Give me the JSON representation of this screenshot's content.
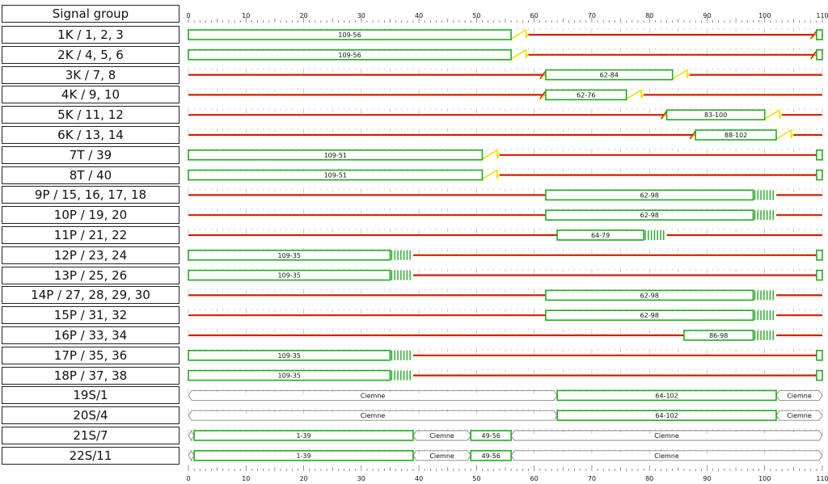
{
  "header_label": "Signal group",
  "chart_data": {
    "type": "timeline",
    "xlim": [
      0,
      110
    ],
    "ticks": [
      0,
      10,
      20,
      30,
      40,
      50,
      60,
      70,
      80,
      90,
      100,
      110
    ],
    "colors": {
      "red": "#cc2200",
      "green": "#22aa22",
      "amber": "#f0e000",
      "grey": "#888888"
    },
    "rows": [
      {
        "label": "1K / 1, 2, 3",
        "kind": "vehicle",
        "greens": [
          {
            "start": 0,
            "end": 56,
            "label": "109-56"
          },
          {
            "start": 109,
            "end": 110,
            "label": ""
          }
        ],
        "ambers": [
          [
            56,
            59
          ]
        ],
        "redambers": [
          [
            108,
            109
          ]
        ]
      },
      {
        "label": "2K / 4, 5, 6",
        "kind": "vehicle",
        "greens": [
          {
            "start": 0,
            "end": 56,
            "label": "109-56"
          },
          {
            "start": 109,
            "end": 110,
            "label": ""
          }
        ],
        "ambers": [
          [
            56,
            59
          ]
        ],
        "redambers": [
          [
            108,
            109
          ]
        ]
      },
      {
        "label": "3K / 7, 8",
        "kind": "vehicle",
        "greens": [
          {
            "start": 62,
            "end": 84,
            "label": "62-84"
          }
        ],
        "ambers": [
          [
            84,
            87
          ]
        ],
        "redambers": [
          [
            61,
            62
          ]
        ]
      },
      {
        "label": "4K / 9, 10",
        "kind": "vehicle",
        "greens": [
          {
            "start": 62,
            "end": 76,
            "label": "62-76"
          }
        ],
        "ambers": [
          [
            76,
            79
          ]
        ],
        "redambers": [
          [
            61,
            62
          ]
        ]
      },
      {
        "label": "5K / 11, 12",
        "kind": "vehicle",
        "greens": [
          {
            "start": 83,
            "end": 100,
            "label": "83-100"
          }
        ],
        "ambers": [
          [
            100,
            103
          ]
        ],
        "redambers": [
          [
            82,
            83
          ]
        ]
      },
      {
        "label": "6K / 13, 14",
        "kind": "vehicle",
        "greens": [
          {
            "start": 88,
            "end": 102,
            "label": "88-102"
          }
        ],
        "ambers": [
          [
            102,
            105
          ]
        ],
        "redambers": [
          [
            87,
            88
          ]
        ]
      },
      {
        "label": "7T / 39",
        "kind": "vehicle",
        "greens": [
          {
            "start": 0,
            "end": 51,
            "label": "109-51"
          },
          {
            "start": 109,
            "end": 110,
            "label": ""
          }
        ],
        "ambers": [
          [
            51,
            54
          ]
        ],
        "redambers": []
      },
      {
        "label": "8T / 40",
        "kind": "vehicle",
        "greens": [
          {
            "start": 0,
            "end": 51,
            "label": "109-51"
          },
          {
            "start": 109,
            "end": 110,
            "label": ""
          }
        ],
        "ambers": [
          [
            51,
            54
          ]
        ],
        "redambers": []
      },
      {
        "label": "9P / 15, 16, 17, 18",
        "kind": "pedestrian",
        "greens": [
          {
            "start": 62,
            "end": 98,
            "label": "62-98"
          }
        ],
        "flashing": [
          [
            98,
            102
          ]
        ]
      },
      {
        "label": "10P / 19, 20",
        "kind": "pedestrian",
        "greens": [
          {
            "start": 62,
            "end": 98,
            "label": "62-98"
          }
        ],
        "flashing": [
          [
            98,
            102
          ]
        ]
      },
      {
        "label": "11P / 21, 22",
        "kind": "pedestrian",
        "greens": [
          {
            "start": 64,
            "end": 79,
            "label": "64-79"
          }
        ],
        "flashing": [
          [
            79,
            83
          ]
        ]
      },
      {
        "label": "12P / 23, 24",
        "kind": "pedestrian",
        "greens": [
          {
            "start": 0,
            "end": 35,
            "label": "109-35"
          },
          {
            "start": 109,
            "end": 110,
            "label": ""
          }
        ],
        "flashing": [
          [
            35,
            39
          ]
        ]
      },
      {
        "label": "13P / 25, 26",
        "kind": "pedestrian",
        "greens": [
          {
            "start": 0,
            "end": 35,
            "label": "109-35"
          },
          {
            "start": 109,
            "end": 110,
            "label": ""
          }
        ],
        "flashing": [
          [
            35,
            39
          ]
        ]
      },
      {
        "label": "14P / 27, 28, 29, 30",
        "kind": "pedestrian",
        "greens": [
          {
            "start": 62,
            "end": 98,
            "label": "62-98"
          }
        ],
        "flashing": [
          [
            98,
            102
          ]
        ]
      },
      {
        "label": "15P / 31, 32",
        "kind": "pedestrian",
        "greens": [
          {
            "start": 62,
            "end": 98,
            "label": "62-98"
          }
        ],
        "flashing": [
          [
            98,
            102
          ]
        ]
      },
      {
        "label": "16P / 33, 34",
        "kind": "pedestrian",
        "greens": [
          {
            "start": 86,
            "end": 98,
            "label": "86-98"
          }
        ],
        "flashing": [
          [
            98,
            102
          ]
        ]
      },
      {
        "label": "17P / 35, 36",
        "kind": "pedestrian",
        "greens": [
          {
            "start": 0,
            "end": 35,
            "label": "109-35"
          },
          {
            "start": 109,
            "end": 110,
            "label": ""
          }
        ],
        "flashing": [
          [
            35,
            39
          ]
        ]
      },
      {
        "label": "18P / 37, 38",
        "kind": "pedestrian",
        "greens": [
          {
            "start": 0,
            "end": 35,
            "label": "109-35"
          },
          {
            "start": 109,
            "end": 110,
            "label": ""
          }
        ],
        "flashing": [
          [
            35,
            39
          ]
        ]
      },
      {
        "label": "19S/1",
        "kind": "signal",
        "greens": [
          {
            "start": 64,
            "end": 102,
            "label": "64-102"
          }
        ],
        "dark": [
          {
            "start": 0,
            "end": 64,
            "label": "Ciemne"
          },
          {
            "start": 102,
            "end": 110,
            "label": "Ciemne"
          }
        ]
      },
      {
        "label": "20S/4",
        "kind": "signal",
        "greens": [
          {
            "start": 64,
            "end": 102,
            "label": "64-102"
          }
        ],
        "dark": [
          {
            "start": 0,
            "end": 64,
            "label": "Ciemne"
          },
          {
            "start": 102,
            "end": 110,
            "label": "Ciemne"
          }
        ]
      },
      {
        "label": "21S/7",
        "kind": "signal",
        "greens": [
          {
            "start": 1,
            "end": 39,
            "label": "1-39"
          },
          {
            "start": 49,
            "end": 56,
            "label": "49-56"
          }
        ],
        "dark": [
          {
            "start": 0,
            "end": 1,
            "label": ""
          },
          {
            "start": 39,
            "end": 49,
            "label": "Ciemne"
          },
          {
            "start": 56,
            "end": 110,
            "label": "Ciemne"
          }
        ]
      },
      {
        "label": "22S/11",
        "kind": "signal",
        "greens": [
          {
            "start": 1,
            "end": 39,
            "label": "1-39"
          },
          {
            "start": 49,
            "end": 56,
            "label": "49-56"
          }
        ],
        "dark": [
          {
            "start": 0,
            "end": 1,
            "label": ""
          },
          {
            "start": 39,
            "end": 49,
            "label": "Ciemne"
          },
          {
            "start": 56,
            "end": 110,
            "label": "Ciemne"
          }
        ]
      }
    ]
  }
}
